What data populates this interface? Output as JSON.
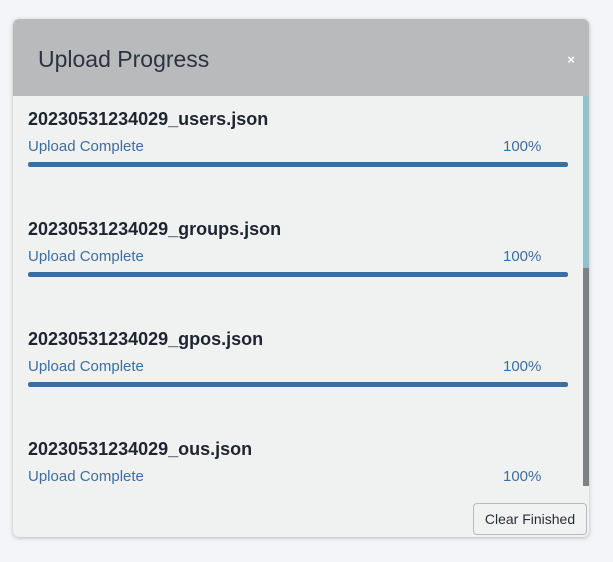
{
  "modal": {
    "title": "Upload Progress",
    "close_label": "×",
    "clear_label": "Clear Finished"
  },
  "uploads": [
    {
      "file_name": "20230531234029_users.json",
      "status": "Upload Complete",
      "percent_label": "100%",
      "progress": 1.0
    },
    {
      "file_name": "20230531234029_groups.json",
      "status": "Upload Complete",
      "percent_label": "100%",
      "progress": 1.0
    },
    {
      "file_name": "20230531234029_gpos.json",
      "status": "Upload Complete",
      "percent_label": "100%",
      "progress": 1.0
    },
    {
      "file_name": "20230531234029_ous.json",
      "status": "Upload Complete",
      "percent_label": "100%",
      "progress": 1.0
    }
  ],
  "colors": {
    "progress_fill": "#3a6f9f",
    "status_text": "#3e6ea0",
    "header_bg": "#b9babc"
  }
}
